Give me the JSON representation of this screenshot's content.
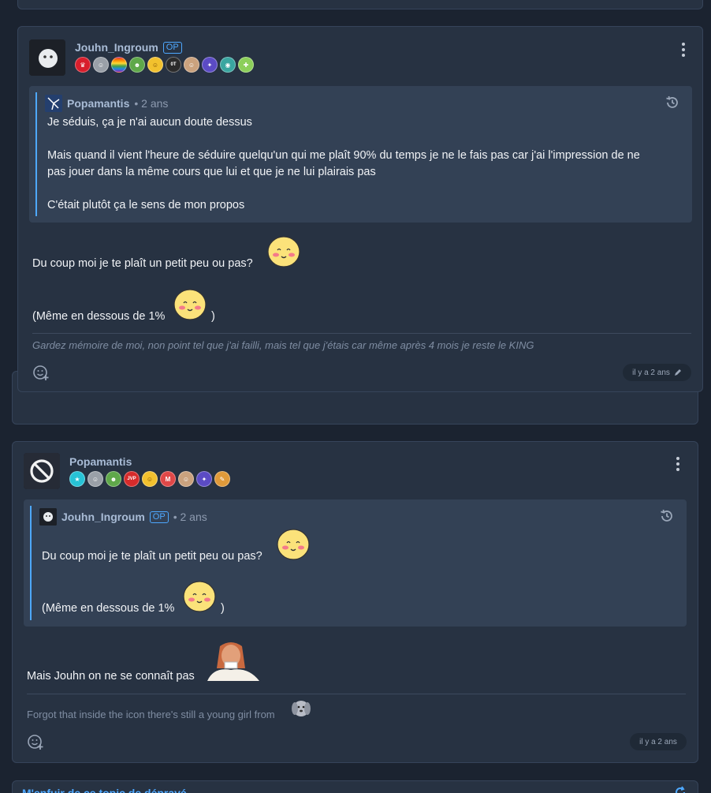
{
  "post1": {
    "author": "Jouhn_Ingroum",
    "op_label": "OP",
    "quote": {
      "author": "Popamantis",
      "age": "• 2 ans",
      "lines": [
        "Je séduis, ça je n'ai aucun doute dessus",
        "Mais quand il vient l'heure de séduire quelqu'un qui me plaît 90% du temps je ne le fais pas car j'ai l'impression de ne",
        "pas jouer dans la même cours que lui et que je ne lui plairais pas",
        "C'était plutôt ça le sens de mon propos"
      ]
    },
    "body_line1": "Du coup moi je te plaît un petit peu ou pas?",
    "body_line2": "(Même en dessous de 1%",
    "body_line2_end": ")",
    "signature": "Gardez mémoire de moi, non point tel que j'ai failli, mais tel que j'étais car même après 4 mois je reste le KING",
    "date": "il y a 2 ans"
  },
  "post2": {
    "author": "Popamantis",
    "quote": {
      "author": "Jouhn_Ingroum",
      "op_label": "OP",
      "age": "• 2 ans",
      "line1": "Du coup moi je te plaît un petit peu ou pas?",
      "line2": "(Même en dessous de 1%",
      "line2_end": ")"
    },
    "body": "Mais Jouhn on ne se connaît pas",
    "signature": "Forgot that inside the icon there's still a young girl from",
    "date": "il y a 2 ans"
  },
  "bottom_nav": {
    "label": "M'enfuir de ce topic de dépravé"
  },
  "colors": {
    "accent": "#4ea8ff",
    "card": "#273242",
    "quote": "#334155",
    "bg": "#1b2330"
  }
}
